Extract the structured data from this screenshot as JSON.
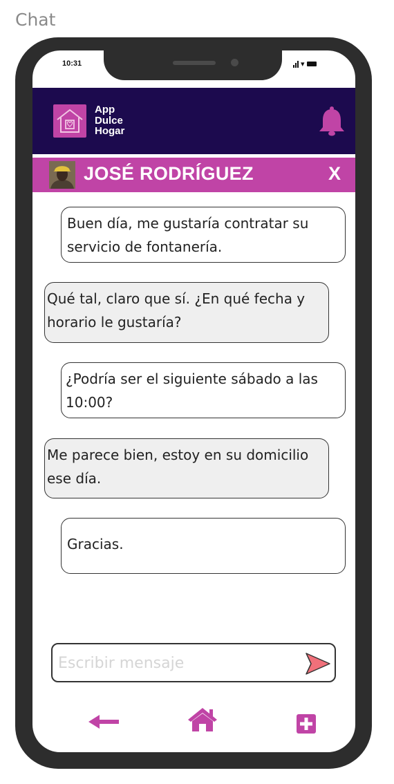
{
  "page": {
    "label": "Chat"
  },
  "status_bar": {
    "time": "10:31"
  },
  "app": {
    "name_lines": [
      "App",
      "Dulce",
      "Hogar"
    ]
  },
  "contact": {
    "name": "JOSÉ RODRÍGUEZ",
    "close_label": "X"
  },
  "messages": [
    {
      "sender": "user",
      "text": "Buen día, me gustaría contratar su servicio de fontanería."
    },
    {
      "sender": "provider",
      "text": "Qué tal, claro que sí. ¿En qué fecha y horario le gustaría?"
    },
    {
      "sender": "user",
      "text": "¿Podría ser el siguiente sábado a las 10:00?"
    },
    {
      "sender": "provider",
      "text": "Me parece bien, estoy en su domicilio ese día."
    },
    {
      "sender": "user",
      "text": "Gracias."
    }
  ],
  "composer": {
    "placeholder": "Escribir mensaje",
    "value": ""
  },
  "colors": {
    "header_bg": "#1c0a4e",
    "accent": "#c044a6",
    "incoming_bubble": "#efefef",
    "outgoing_bubble": "#ffffff",
    "send_icon": "#f0707a"
  },
  "icons": [
    "home-logo-icon",
    "bell-icon",
    "avatar",
    "send-icon",
    "back-arrow-icon",
    "home-icon",
    "add-icon"
  ]
}
